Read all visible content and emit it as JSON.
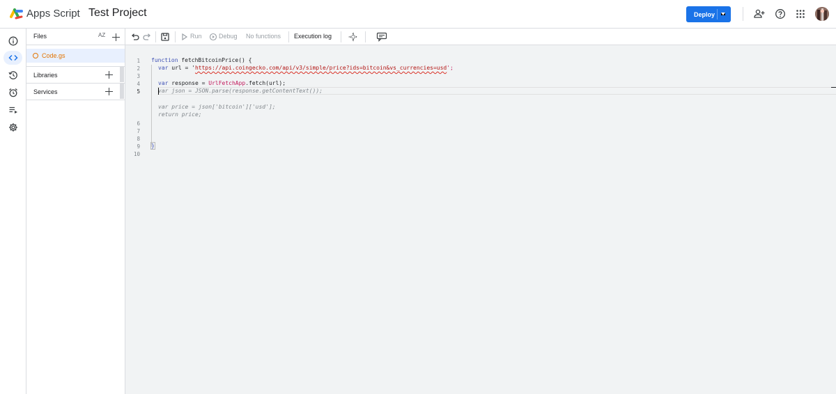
{
  "header": {
    "app_name": "Apps Script",
    "project_name": "Test Project",
    "deploy_label": "Deploy",
    "icons": [
      "add-person-icon",
      "help-icon",
      "apps-grid-icon",
      "account-avatar"
    ]
  },
  "rail": {
    "items": [
      {
        "name": "overview",
        "icon": "info-icon"
      },
      {
        "name": "editor",
        "icon": "code-icon",
        "active": true
      },
      {
        "name": "triggers-history",
        "icon": "history-icon"
      },
      {
        "name": "triggers",
        "icon": "alarm-icon"
      },
      {
        "name": "executions",
        "icon": "list-play-icon"
      },
      {
        "name": "settings",
        "icon": "gear-icon"
      }
    ]
  },
  "files": {
    "title": "Files",
    "sort_label": "AZ",
    "items": [
      {
        "name": "Code.gs"
      }
    ],
    "sections": [
      {
        "label": "Libraries"
      },
      {
        "label": "Services"
      }
    ]
  },
  "toolbar": {
    "run_label": "Run",
    "debug_label": "Debug",
    "function_select": "No functions",
    "execution_log_label": "Execution log"
  },
  "editor": {
    "line_numbers": [
      "1",
      "2",
      "3",
      "4",
      "5",
      "6",
      "7",
      "8",
      "9",
      "10"
    ],
    "current_line": "5",
    "line1_kw": "function",
    "line1_name": " fetchBitcoinPrice() {",
    "line2_kw": "var",
    "line2_mid": " url = '",
    "line2_url": "https://api.coingecko.com/api/v3/simple/price?ids=bitcoin&vs_currencies=usd",
    "line2_end": "';",
    "line4_kw": "var",
    "line4_mid": " response = ",
    "line4_obj": "UrlFetchApp",
    "line4_end": ".fetch(url);",
    "ghost1": "var json = JSON.parse(response.getContentText());",
    "ghost2": "var price = json['bitcoin']['usd'];",
    "ghost3": "return price;",
    "line9": "}"
  },
  "colors": {
    "accent": "#1a73e8",
    "file_color": "#e37400",
    "active_bg": "#e8f0fe",
    "editor_bg": "#f1f3f4"
  }
}
